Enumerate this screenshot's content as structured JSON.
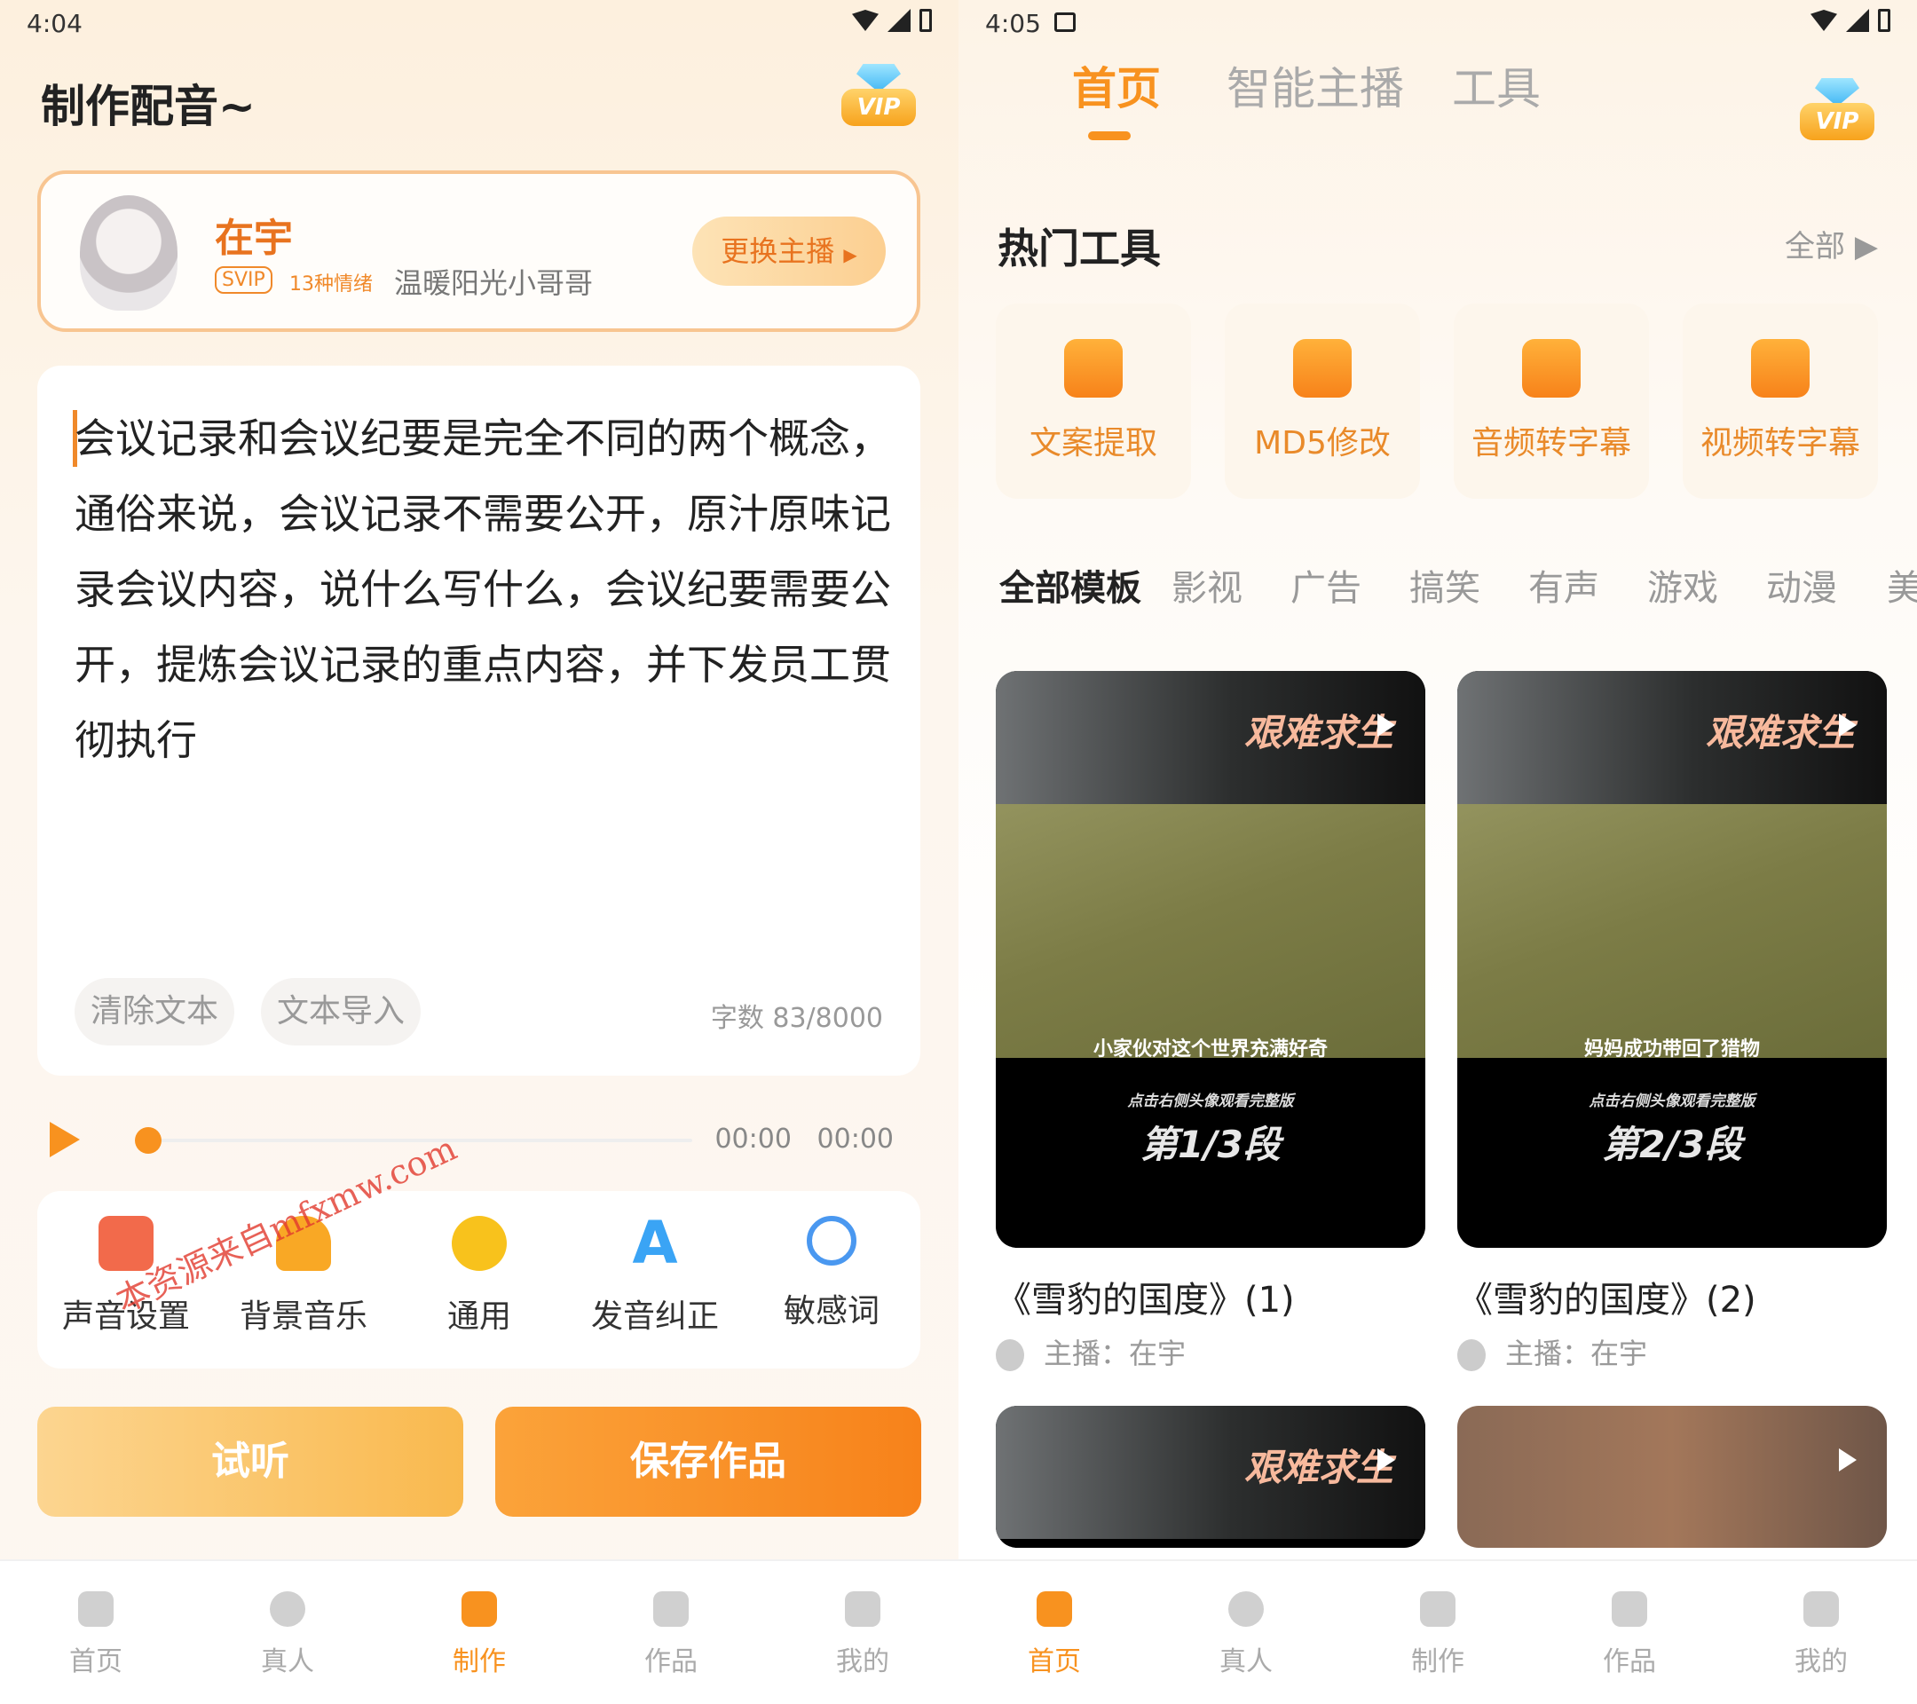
{
  "left": {
    "status_time": "4:04",
    "title": "制作配音~",
    "vip_label": "VIP",
    "anchor": {
      "name": "在宇",
      "badge": "SVIP",
      "emotions": "13种情绪",
      "desc": "温暖阳光小哥哥",
      "change_btn": "更换主播"
    },
    "text": "会议记录和会议纪要是完全不同的两个概念，通俗来说，会议记录不需要公开，原汁原味记录会议内容，说什么写什么，会议纪要需要公开，提炼会议记录的重点内容，并下发员工贯彻执行",
    "clear_btn": "清除文本",
    "import_btn": "文本导入",
    "char_count": "字数 83/8000",
    "player": {
      "current": "00:00",
      "total": "00:00"
    },
    "tools": [
      {
        "label": "声音设置",
        "icon": "equalizer-icon",
        "color": "#f26a4b"
      },
      {
        "label": "背景音乐",
        "icon": "headphones-icon",
        "color": "#f9a825"
      },
      {
        "label": "通用",
        "icon": "smiley-icon",
        "color": "#f8c21c"
      },
      {
        "label": "发音纠正",
        "icon": "letter-a-icon",
        "color": "#3aa4f5"
      },
      {
        "label": "敏感词",
        "icon": "prohibited-icon",
        "color": "#4a98f0"
      }
    ],
    "listen_btn": "试听",
    "save_btn": "保存作品",
    "watermark": "本资源来自mfxmw.com"
  },
  "right": {
    "status_time": "4:05",
    "vip_label": "VIP",
    "top_tabs": [
      "首页",
      "智能主播",
      "工具"
    ],
    "hot_tools_title": "热门工具",
    "all_link": "全部 ▶",
    "hot_tools": [
      {
        "label": "文案提取",
        "icon": "text-extract-icon"
      },
      {
        "label": "MD5修改",
        "icon": "md5-icon"
      },
      {
        "label": "音频转字幕",
        "icon": "audio-subtitle-icon"
      },
      {
        "label": "视频转字幕",
        "icon": "video-subtitle-icon"
      }
    ],
    "categories": [
      "全部模板",
      "影视",
      "广告",
      "搞笑",
      "有声",
      "游戏",
      "动漫",
      "美"
    ],
    "videos": [
      {
        "title": "《雪豹的国度》(1)",
        "anchor": "主播：在宇",
        "header": "艰难求生",
        "caption": "小家伙对这个世界充满好奇",
        "hint": "点击右侧头像观看完整版",
        "segment": "第1/3段"
      },
      {
        "title": "《雪豹的国度》(2)",
        "anchor": "主播：在宇",
        "header": "艰难求生",
        "caption": "妈妈成功带回了猎物",
        "hint": "点击右侧头像观看完整版",
        "segment": "第2/3段"
      },
      {
        "header": "艰难求生"
      }
    ]
  },
  "tabbar_left": [
    {
      "label": "首页",
      "icon": "home-icon"
    },
    {
      "label": "真人",
      "icon": "person-icon"
    },
    {
      "label": "制作",
      "icon": "waveform-icon",
      "active": true
    },
    {
      "label": "作品",
      "icon": "document-icon"
    },
    {
      "label": "我的",
      "icon": "profile-icon"
    }
  ],
  "tabbar_right": [
    {
      "label": "首页",
      "icon": "home-icon",
      "active": true
    },
    {
      "label": "真人",
      "icon": "person-icon"
    },
    {
      "label": "制作",
      "icon": "waveform-icon"
    },
    {
      "label": "作品",
      "icon": "document-icon"
    },
    {
      "label": "我的",
      "icon": "profile-icon"
    }
  ]
}
